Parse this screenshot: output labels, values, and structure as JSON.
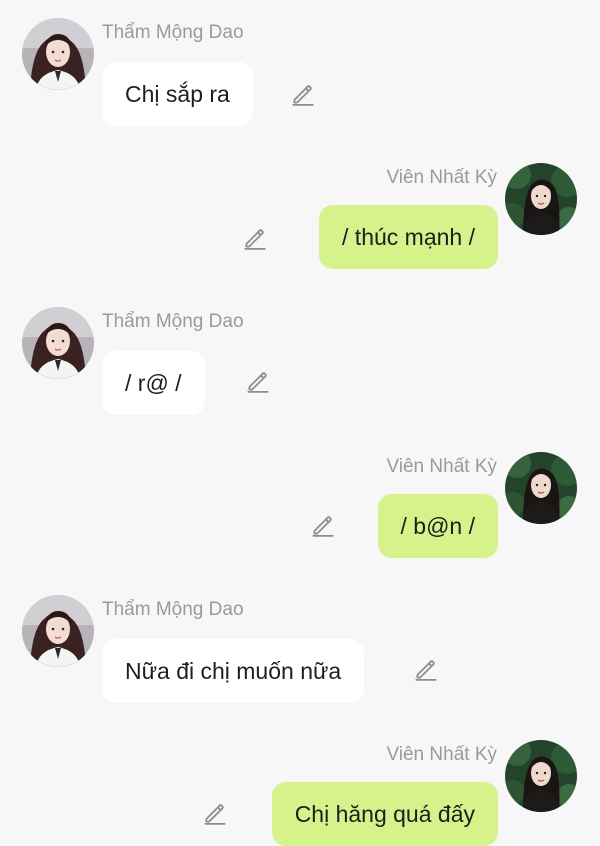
{
  "messages": [
    {
      "side": "left",
      "sender": "Thẩm Mộng Dao",
      "text": "Chị sắp ra",
      "edit_icon": "pencil-edit-icon",
      "avatar": "female-avatar-light"
    },
    {
      "side": "right",
      "sender": "Viên Nhất Kỳ",
      "text": "/ thúc mạnh /",
      "edit_icon": "pencil-edit-icon",
      "avatar": "female-avatar-forest"
    },
    {
      "side": "left",
      "sender": "Thẩm Mộng Dao",
      "text": "/ r@ /",
      "edit_icon": "pencil-edit-icon",
      "avatar": "female-avatar-light"
    },
    {
      "side": "right",
      "sender": "Viên Nhất Kỳ",
      "text": "/ b@n /",
      "edit_icon": "pencil-edit-icon",
      "avatar": "female-avatar-forest"
    },
    {
      "side": "left",
      "sender": "Thẩm Mộng Dao",
      "text": "Nữa đi chị muốn nữa",
      "edit_icon": "pencil-edit-icon",
      "avatar": "female-avatar-light"
    },
    {
      "side": "right",
      "sender": "Viên Nhất Kỳ",
      "text": "Chị hăng quá đấy",
      "edit_icon": "pencil-edit-icon",
      "avatar": "female-avatar-forest"
    }
  ],
  "colors": {
    "background": "#f7f7f7",
    "incoming_bubble": "#ffffff",
    "outgoing_bubble": "#d6f28a",
    "sender_name": "#9a9a9a",
    "message_text": "#1e1e1e",
    "edit_icon": "#8c8c8c"
  }
}
